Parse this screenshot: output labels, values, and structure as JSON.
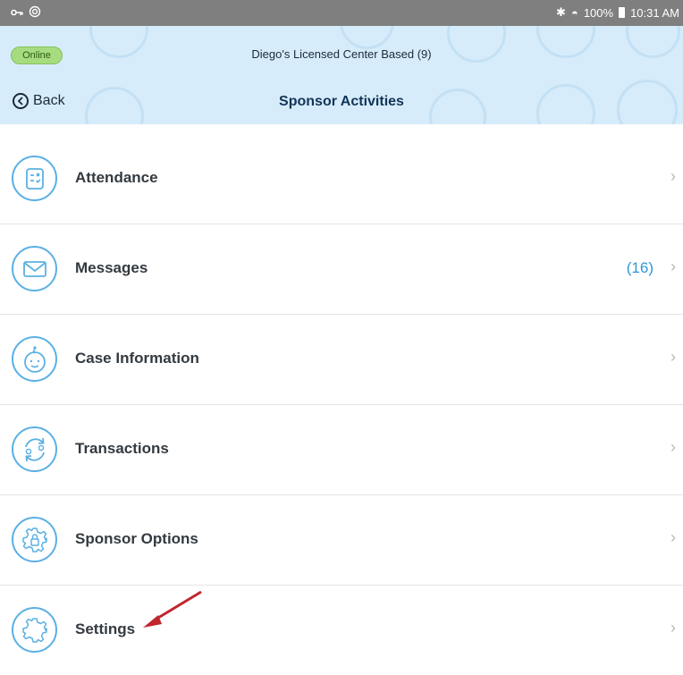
{
  "status_bar": {
    "left_icons": [
      "key-icon",
      "vpn-icon"
    ],
    "bluetooth": "✱",
    "wifi": "◓",
    "battery": "100%",
    "time": "10:31 AM"
  },
  "header": {
    "status": "Online",
    "center_name": "Diego's Licensed Center Based (9)",
    "back_label": "Back",
    "title": "Sponsor Activities"
  },
  "menu": {
    "items": [
      {
        "label": "Attendance",
        "icon": "attendance-icon",
        "count": ""
      },
      {
        "label": "Messages",
        "icon": "envelope-icon",
        "count": "(16)"
      },
      {
        "label": "Case Information",
        "icon": "baby-face-icon",
        "count": ""
      },
      {
        "label": "Transactions",
        "icon": "sync-arrows-icon",
        "count": ""
      },
      {
        "label": "Sponsor Options",
        "icon": "gear-lock-icon",
        "count": ""
      },
      {
        "label": "Settings",
        "icon": "gear-icon",
        "count": ""
      }
    ],
    "chevron": "›"
  },
  "colors": {
    "header_bg": "#d6ecfb",
    "status_bar_bg": "#7f7f7f",
    "accent": "#5ab0e4",
    "count": "#2e97db",
    "online": "#a6dc7f",
    "annotation_arrow": "#c0262d"
  }
}
